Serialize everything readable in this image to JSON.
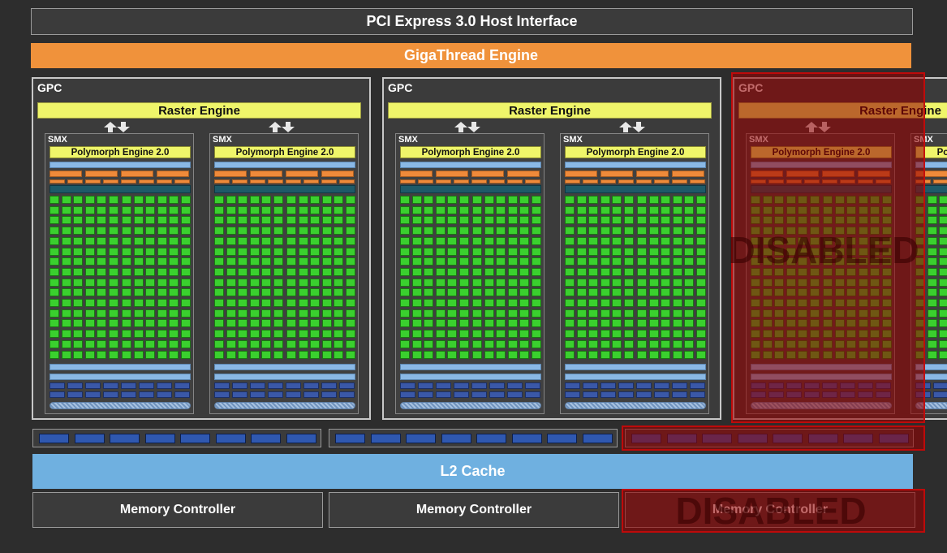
{
  "pci_label": "PCI Express 3.0 Host Interface",
  "giga_label": "GigaThread Engine",
  "l2_label": "L2 Cache",
  "gpc_label": "GPC",
  "raster_label": "Raster Engine",
  "smx_label": "SMX",
  "polymorph_label": "Polymorph Engine 2.0",
  "memory_controller_label": "Memory Controller",
  "disabled_label": "DISABLED",
  "colors": {
    "background": "#2d2d2d",
    "panel": "#3b3b3b",
    "gigathread": "#f0923b",
    "raster_polymorph": "#eff56a",
    "cuda_core": "#3ad02e",
    "l2_cache": "#6fb0e0",
    "load_store": "#3a58a8",
    "disabled_overlay": "#960000"
  }
}
